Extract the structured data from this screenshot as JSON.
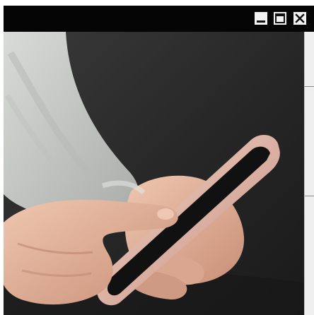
{
  "window": {
    "controls": [
      {
        "name": "minimize",
        "icon": "minimize-icon"
      },
      {
        "name": "maximize",
        "icon": "maximize-icon"
      },
      {
        "name": "close",
        "icon": "close-icon"
      }
    ]
  },
  "image": {
    "alt": "",
    "colors": {
      "background": "#2a2a2a",
      "sweater": "#c9ccc8",
      "skin": "#e2b39c",
      "phone_body": "#d9a79a",
      "phone_screen": "#111111"
    }
  },
  "side_panel": {
    "background": "#efefef"
  }
}
